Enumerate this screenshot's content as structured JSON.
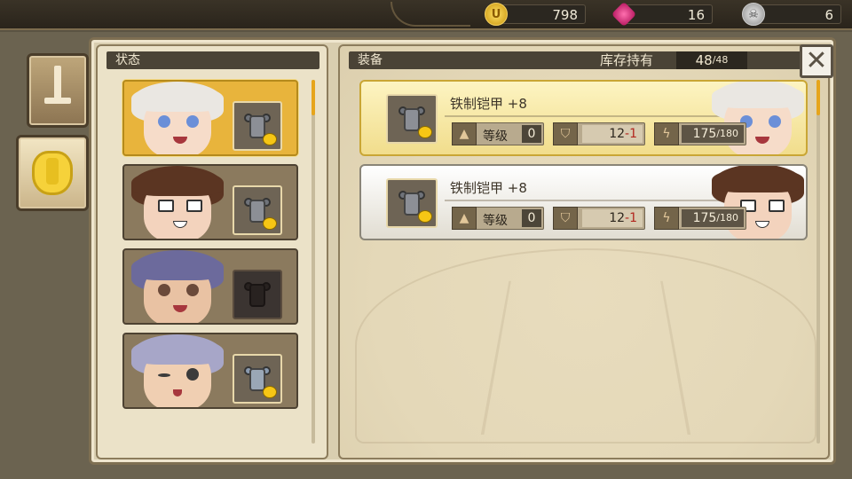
{
  "currencies": {
    "gold": {
      "icon": "gold-coin-icon",
      "value": "798",
      "glyph": "U"
    },
    "gem": {
      "icon": "pink-gem-icon",
      "value": "16",
      "glyph": "◆"
    },
    "token": {
      "icon": "silver-token-icon",
      "value": "6",
      "glyph": "☠"
    }
  },
  "sidebar": {
    "tabs": [
      {
        "id": "weapon",
        "icon": "sword-icon"
      },
      {
        "id": "armor",
        "icon": "armor-icon",
        "active": true
      }
    ]
  },
  "left_panel": {
    "title": "状态",
    "characters": [
      {
        "name": "white-haired-girl",
        "hair": "#eae7e2",
        "eye": "#6b8fd8",
        "has_equipment": true,
        "selected": true
      },
      {
        "name": "glasses-boy",
        "hair": "#5b3522",
        "eye": "#5b3a2a",
        "has_equipment": true,
        "selected": false
      },
      {
        "name": "purple-haired-boy",
        "hair": "#6c6a9c",
        "eye": "#6b4a3a",
        "has_equipment": false,
        "selected": false
      },
      {
        "name": "elf-man",
        "hair": "#a7a6c8",
        "eye": "#3b3b3b",
        "has_equipment": true,
        "selected": false
      }
    ]
  },
  "right_panel": {
    "title": "装备",
    "stock_label": "库存持有",
    "stock_count": "48",
    "stock_max": "/48",
    "close_label": "✕",
    "items": [
      {
        "name": "铁制铠甲 +8",
        "level_label": "等级",
        "level": "0",
        "defense_base": "12",
        "defense_sep": "-",
        "defense_mod": "1",
        "durability": "175",
        "durability_max": "/180",
        "owner": "white-haired-girl",
        "selected": true
      },
      {
        "name": "铁制铠甲 +8",
        "level_label": "等级",
        "level": "0",
        "defense_base": "12",
        "defense_sep": "-",
        "defense_mod": "1",
        "durability": "175",
        "durability_max": "/180",
        "owner": "glasses-boy",
        "selected": false
      }
    ]
  },
  "colors": {
    "accent_gold": "#e8b43c",
    "scroll_thumb": "#e6a51c",
    "negative_mod": "#b3261e"
  }
}
